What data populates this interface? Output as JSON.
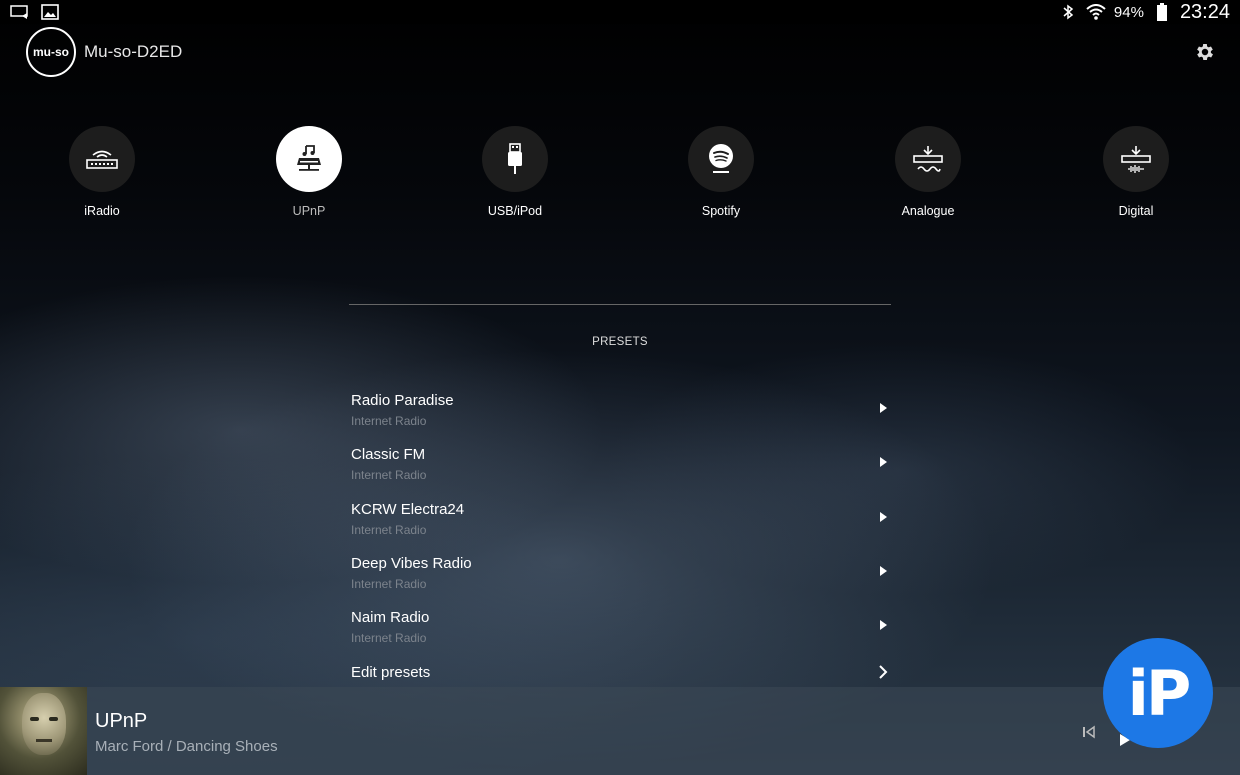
{
  "status_bar": {
    "left_icons": [
      "cast-icon",
      "gallery-icon"
    ],
    "right_icons": [
      "bluetooth-icon",
      "wifi-icon",
      "battery-icon"
    ],
    "battery": "94%",
    "time": "23:24"
  },
  "header": {
    "logo_text": "mu-so",
    "device_name": "Mu-so-D2ED",
    "settings_icon": "gear-icon"
  },
  "sources": [
    {
      "label": "iRadio",
      "icon": "router-icon",
      "active": false
    },
    {
      "label": "UPnP",
      "icon": "upnp-server-icon",
      "active": true
    },
    {
      "label": "USB/iPod",
      "icon": "usb-icon",
      "active": false
    },
    {
      "label": "Spotify",
      "icon": "spotify-icon",
      "active": false
    },
    {
      "label": "Analogue",
      "icon": "analogue-input-icon",
      "active": false
    },
    {
      "label": "Digital",
      "icon": "digital-input-icon",
      "active": false
    }
  ],
  "presets": {
    "title": "PRESETS",
    "items": [
      {
        "name": "Radio Paradise",
        "type": "Internet Radio"
      },
      {
        "name": "Classic FM",
        "type": "Internet Radio"
      },
      {
        "name": "KCRW Electra24",
        "type": "Internet Radio"
      },
      {
        "name": "Deep Vibes Radio",
        "type": "Internet Radio"
      },
      {
        "name": "Naim Radio",
        "type": "Internet Radio"
      }
    ],
    "edit_label": "Edit presets"
  },
  "now_playing": {
    "source": "UPnP",
    "track": "Marc Ford / Dancing Shoes"
  },
  "badge": {
    "text": "iP",
    "color": "#1d78e6"
  }
}
